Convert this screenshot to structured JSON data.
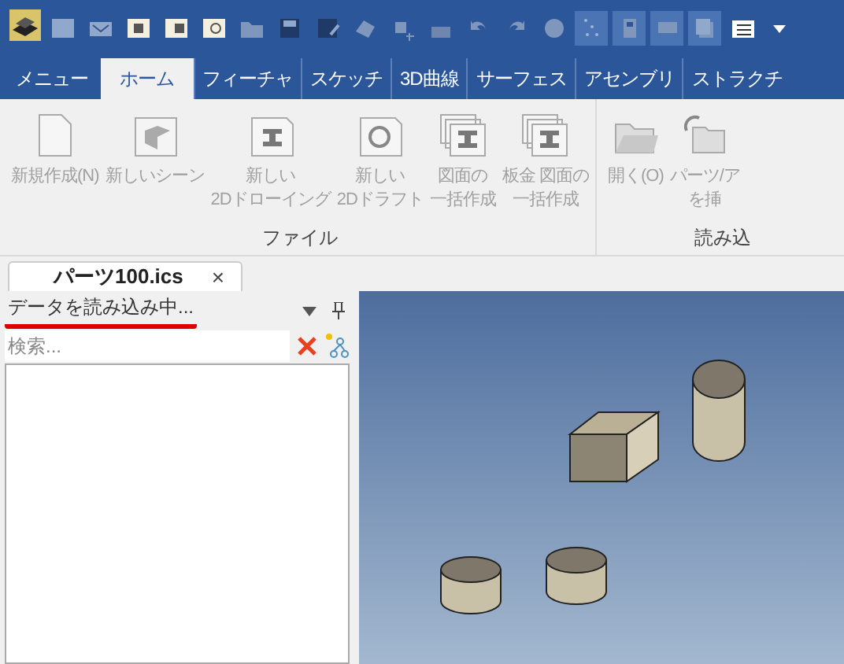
{
  "quick_access": [
    {
      "selected": false
    },
    {
      "selected": false
    },
    {
      "selected": false
    },
    {
      "selected": false
    },
    {
      "selected": false
    },
    {
      "selected": false
    },
    {
      "selected": false
    },
    {
      "selected": false
    },
    {
      "selected": false
    },
    {
      "selected": false
    },
    {
      "selected": false
    },
    {
      "selected": false
    },
    {
      "selected": false
    },
    {
      "selected": false
    },
    {
      "selected": true
    },
    {
      "selected": true
    },
    {
      "selected": true
    },
    {
      "selected": true
    },
    {
      "selected": false
    }
  ],
  "tabs": [
    {
      "label": "メニュー",
      "selected": false
    },
    {
      "label": "ホーム",
      "selected": true
    },
    {
      "label": "フィーチャ",
      "selected": false
    },
    {
      "label": "スケッチ",
      "selected": false
    },
    {
      "label": "3D曲線",
      "selected": false
    },
    {
      "label": "サーフェス",
      "selected": false
    },
    {
      "label": "アセンブリ",
      "selected": false
    },
    {
      "label": "ストラクチ",
      "selected": false
    }
  ],
  "ribbon_groups": [
    {
      "label": "ファイル",
      "buttons": [
        {
          "label": "新規作成(N)",
          "kind": "page",
          "disabled": true
        },
        {
          "label": "新しいシーン",
          "kind": "scene",
          "disabled": true
        },
        {
          "label": "新しい\n2Dドローイング",
          "kind": "drawing",
          "disabled": true
        },
        {
          "label": "新しい\n2Dドラフト",
          "kind": "draft",
          "disabled": true
        },
        {
          "lines": [
            "図面の",
            "一括作成"
          ],
          "kind": "batch",
          "disabled": true
        },
        {
          "lines": [
            "板金 図面の",
            "一括作成"
          ],
          "kind": "batch",
          "disabled": true
        }
      ]
    },
    {
      "label": "読み込",
      "buttons": [
        {
          "label": "開く(O)",
          "kind": "folder",
          "disabled": true
        },
        {
          "lines": [
            "パーツ/ア",
            "を挿"
          ],
          "kind": "insert",
          "disabled": true
        }
      ]
    }
  ],
  "document_tab": {
    "label": "パーツ100.ics",
    "close": "×"
  },
  "panel": {
    "status": "データを読み込み中...",
    "highlighted": true,
    "search": {
      "placeholder": "検索..."
    }
  }
}
